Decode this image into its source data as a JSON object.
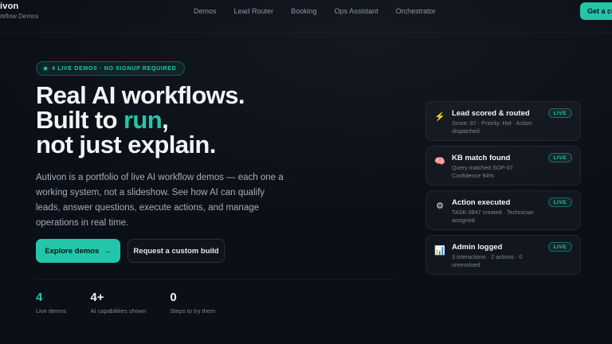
{
  "brand": {
    "name": "ivon",
    "subtitle": "rkflow Demos"
  },
  "nav": {
    "items": [
      "Demos",
      "Lead Router",
      "Booking",
      "Ops Assistant",
      "Orchestrator"
    ]
  },
  "header": {
    "cta_label": "Get a cu"
  },
  "hero": {
    "pill_text": "4 LIVE DEMOS · NO SIGNUP REQUIRED",
    "headline": {
      "line1": "Real AI workflows.",
      "line2_prefix": "Built to ",
      "line2_accent": "run",
      "line2_suffix": ",",
      "line3": "not just explain."
    },
    "description": "Autivon is a portfolio of live AI workflow demos — each one a working system, not a slideshow. See how AI can qualify leads, answer questions, execute actions, and manage operations in real time.",
    "buttons": {
      "primary_label": "Explore demos",
      "primary_arrow": "→",
      "secondary_label": "Request a custom build"
    },
    "stats": [
      {
        "value": "4",
        "label": "Live demos"
      },
      {
        "value": "4+",
        "label": "AI capabilities shown"
      },
      {
        "value": "0",
        "label": "Steps to try them"
      }
    ]
  },
  "cards": [
    {
      "icon": "lightning-icon",
      "icon_glyph": "⚡",
      "title": "Lead scored & routed",
      "subtitle": "Score: 87 · Priority: Hot · Action dispatched",
      "badge": "LIVE"
    },
    {
      "icon": "brain-icon",
      "icon_glyph": "🧠",
      "title": "KB match found",
      "subtitle": "Query matched SOP-07 · Confidence 94%",
      "badge": "LIVE"
    },
    {
      "icon": "gear-icon",
      "icon_glyph": "⚙",
      "title": "Action executed",
      "subtitle": "TASK-3847 created · Technician assigned",
      "badge": "LIVE"
    },
    {
      "icon": "bar-chart-icon",
      "icon_glyph": "📊",
      "title": "Admin logged",
      "subtitle": "3 interactions · 2 actions · 0 unresolved",
      "badge": "LIVE"
    }
  ],
  "colors": {
    "background": "#0b0f17",
    "accent": "#22c7a9",
    "text_primary": "#f3f4f6",
    "text_muted": "#7c8796"
  }
}
